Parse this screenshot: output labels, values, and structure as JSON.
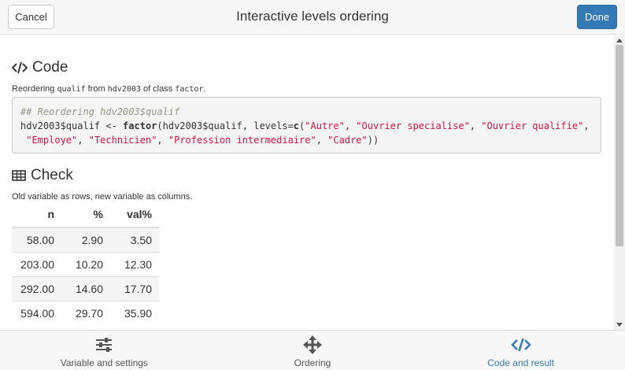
{
  "header": {
    "cancel_label": "Cancel",
    "title": "Interactive levels ordering",
    "done_label": "Done"
  },
  "code_section": {
    "heading": "Code",
    "desc_prefix": "Reordering ",
    "variable": "qualif",
    "desc_from": " from ",
    "dataset": "hdv2003",
    "desc_class": " of class ",
    "class_name": "factor",
    "desc_end": ".",
    "comment": "## Reordering hdv2003$qualif",
    "assign_prefix": "hdv2003$qualif <- ",
    "func": "factor",
    "func_args_start": "(hdv2003$qualif, levels=",
    "c_func": "c",
    "paren_open": "(",
    "levels": [
      "\"Autre\"",
      "\"Ouvrier specialise\"",
      "\"Ouvrier qualifie\"",
      "\"Employe\"",
      "\"Technicien\"",
      "\"Profession intermediaire\"",
      "\"Cadre\""
    ],
    "sep": ", ",
    "closing": "))"
  },
  "check_section": {
    "heading": "Check",
    "desc": "Old variable as rows, new variable as columns.",
    "columns": [
      "n",
      "%",
      "val%"
    ],
    "rows": [
      [
        "58.00",
        "2.90",
        "3.50"
      ],
      [
        "203.00",
        "10.20",
        "12.30"
      ],
      [
        "292.00",
        "14.60",
        "17.70"
      ],
      [
        "594.00",
        "29.70",
        "35.90"
      ]
    ]
  },
  "tabs": [
    {
      "label": "Variable and settings",
      "icon": "sliders-icon",
      "active": false
    },
    {
      "label": "Ordering",
      "icon": "move-arrows-icon",
      "active": false
    },
    {
      "label": "Code and result",
      "icon": "code-icon",
      "active": true
    }
  ],
  "colors": {
    "accent": "#337ab7",
    "string": "#dd1144",
    "comment": "#999988"
  }
}
